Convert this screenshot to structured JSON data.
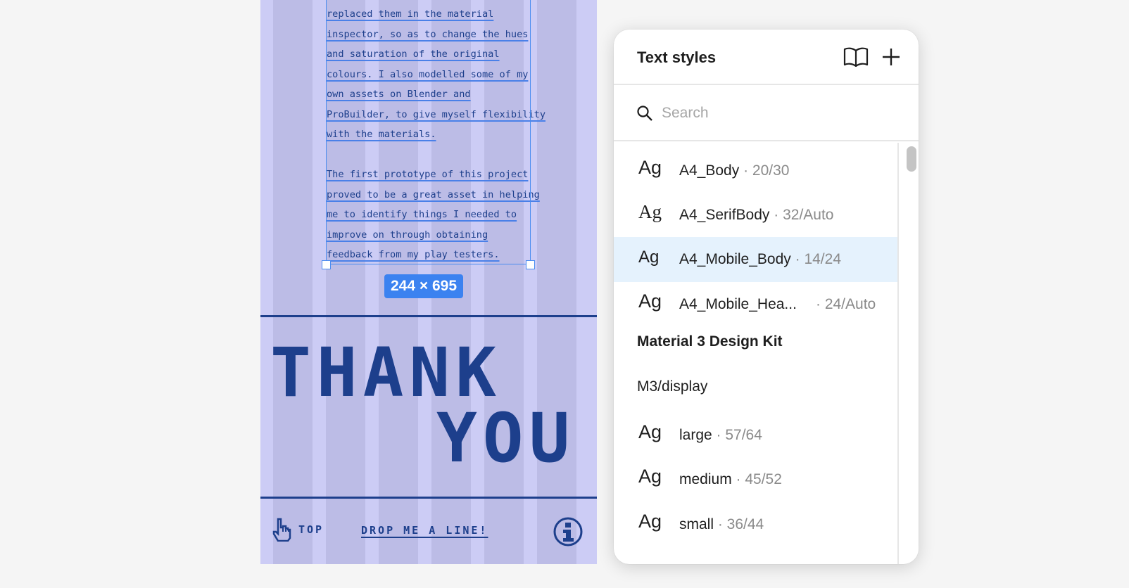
{
  "canvas": {
    "body_lines": [
      "replaced them in the material",
      "inspector, so as to change the hues",
      "and saturation of the original",
      "colours. I also modelled some of my",
      "own assets on Blender and",
      "ProBuilder, to give myself flexibility",
      "with the materials."
    ],
    "body_lines_2": [
      "The first prototype of this project",
      "proved to be a great asset in helping",
      "me to identify things I needed to",
      "improve on through obtaining",
      "feedback from my play testers."
    ],
    "size_badge": "244 × 695",
    "heading_line1": "THANK",
    "heading_line2": "YOU",
    "nav_top_label": "TOP",
    "nav_drop_label": "DROP ME A LINE!",
    "frame_color": "#ccccf5",
    "column_color": "#bcbce6",
    "ink_color": "#1d3f8c",
    "selection_color": "#4a8cf0"
  },
  "panel": {
    "title": "Text styles",
    "library_icon": "book-open-icon",
    "add_icon": "plus-icon",
    "search_placeholder": "Search",
    "styles": [
      {
        "preview": "Ag",
        "name": "A4_Body",
        "meta": " · 20/30"
      },
      {
        "preview": "Ag",
        "name": "A4_SerifBody",
        "meta": " · 32/Auto"
      },
      {
        "preview": "Ag",
        "name": "A4_Mobile_Body",
        "meta": " · 14/24",
        "selected": true
      },
      {
        "preview": "Ag",
        "name": "A4_Mobile_Hea...",
        "meta": "· 24/Auto"
      }
    ],
    "library_name": "Material 3 Design Kit",
    "group_name": "M3/display",
    "m3_styles": [
      {
        "preview": "Ag",
        "name": "large",
        "meta": " · 57/64"
      },
      {
        "preview": "Ag",
        "name": "medium",
        "meta": " · 45/52"
      },
      {
        "preview": "Ag",
        "name": "small",
        "meta": " · 36/44"
      }
    ],
    "selected_row_color": "#e5f2fd"
  }
}
